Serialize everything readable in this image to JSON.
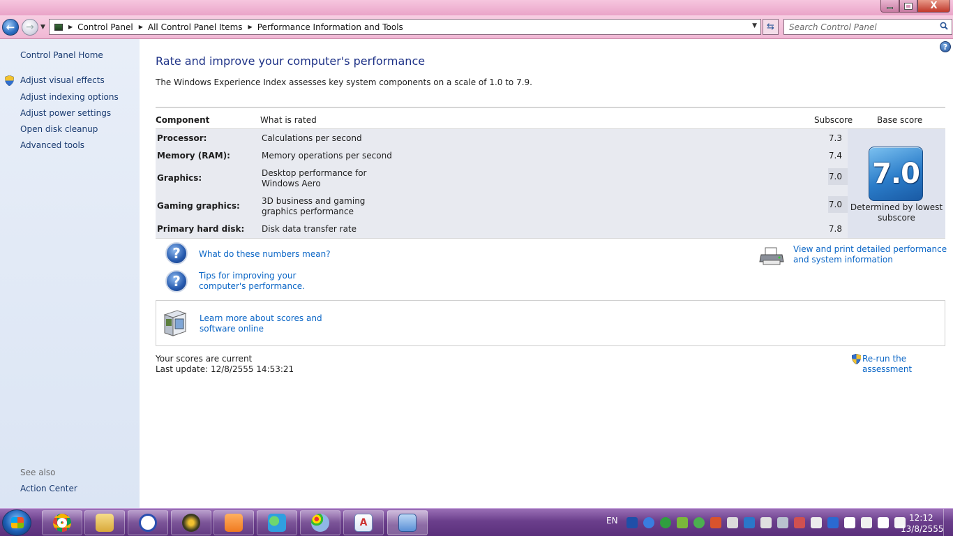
{
  "window": {
    "minimize_symbol": "",
    "maximize_symbol": "",
    "close_symbol": "X"
  },
  "navbar": {
    "back_symbol": "←",
    "forward_symbol": "→",
    "breadcrumb": [
      "Control Panel",
      "All Control Panel Items",
      "Performance Information and Tools"
    ],
    "separator": "▶",
    "search_placeholder": "Search Control Panel",
    "refresh_symbol": "⇆"
  },
  "sidebar": {
    "home": "Control Panel Home",
    "items": [
      {
        "label": "Adjust visual effects",
        "shield": true
      },
      {
        "label": "Adjust indexing options",
        "shield": false
      },
      {
        "label": "Adjust power settings",
        "shield": false
      },
      {
        "label": "Open disk cleanup",
        "shield": false
      },
      {
        "label": "Advanced tools",
        "shield": false
      }
    ],
    "see_also_title": "See also",
    "see_also_items": [
      "Action Center"
    ]
  },
  "main": {
    "help_symbol": "?",
    "title": "Rate and improve your computer's performance",
    "description": "The Windows Experience Index assesses key system components on a scale of 1.0 to 7.9.",
    "table": {
      "headers": {
        "component": "Component",
        "what": "What is rated",
        "subscore": "Subscore",
        "base": "Base score"
      },
      "rows": [
        {
          "component": "Processor:",
          "what": "Calculations per second",
          "subscore": "7.3"
        },
        {
          "component": "Memory (RAM):",
          "what": "Memory operations per second",
          "subscore": "7.4"
        },
        {
          "component": "Graphics:",
          "what": "Desktop performance for Windows Aero",
          "subscore": "7.0"
        },
        {
          "component": "Gaming graphics:",
          "what": "3D business and gaming graphics performance",
          "subscore": "7.0"
        },
        {
          "component": "Primary hard disk:",
          "what": "Disk data transfer rate",
          "subscore": "7.8"
        }
      ],
      "base_score": "7.0",
      "base_caption": "Determined by lowest subscore"
    },
    "links": {
      "numbers_meaning": "What do these numbers mean?",
      "tips": "Tips for improving your computer's performance.",
      "view_print": "View and print detailed performance and system information",
      "learn_more": "Learn more about scores and software online",
      "rerun": "Re-run the assessment"
    },
    "status": {
      "current": "Your scores are current",
      "last_update": "Last update: 12/8/2555 14:53:21"
    }
  },
  "taskbar": {
    "apps": [
      {
        "name": "chrome",
        "color": "#e4423a"
      },
      {
        "name": "file-explorer",
        "color": "#e7c060"
      },
      {
        "name": "daemon-tools",
        "color": "#2a4fb0"
      },
      {
        "name": "media-app",
        "color": "#3a3a20"
      },
      {
        "name": "media-player",
        "color": "#f07a20"
      },
      {
        "name": "messenger",
        "color": "#3fb04a"
      },
      {
        "name": "paint",
        "color": "#8fb7e6"
      },
      {
        "name": "wordpad",
        "color": "#e8eef8"
      },
      {
        "name": "control-panel",
        "color": "#5a8fd6"
      }
    ],
    "language": "EN",
    "time": "12:12",
    "date": "13/8/2555"
  },
  "colors": {
    "title_text": "#1e3287",
    "link": "#0b66c6",
    "sidebar_link": "#1a3b71",
    "chrome_pink": "#f0b7d4",
    "taskbar_purple": "#6b3f8c"
  }
}
